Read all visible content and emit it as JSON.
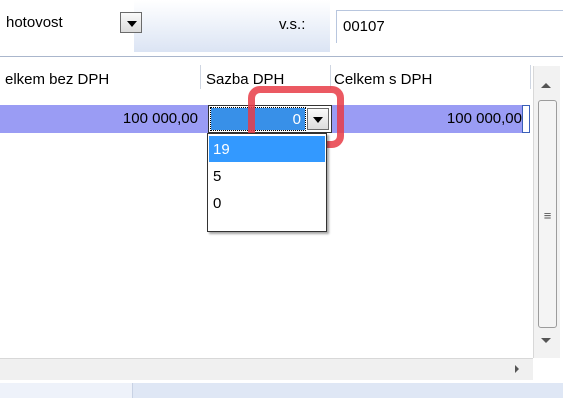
{
  "header": {
    "payment_method": "hotovost",
    "vs_label": "v.s.:",
    "vs_value": "00107"
  },
  "grid": {
    "columns": [
      "elkem bez DPH",
      "Sazba DPH",
      "Celkem s DPH"
    ],
    "row": {
      "total_without_vat": "100 000,00",
      "vat_rate": "0",
      "total_with_vat": "100 000,00"
    }
  },
  "dropdown": {
    "options": [
      "19",
      "5",
      "0"
    ],
    "highlighted_index": 0
  },
  "scrollbar": {
    "grip": "≡"
  },
  "colors": {
    "row_selected": "#9a9cf4",
    "option_highlight": "#3399ff",
    "annotation": "#e83c46"
  }
}
